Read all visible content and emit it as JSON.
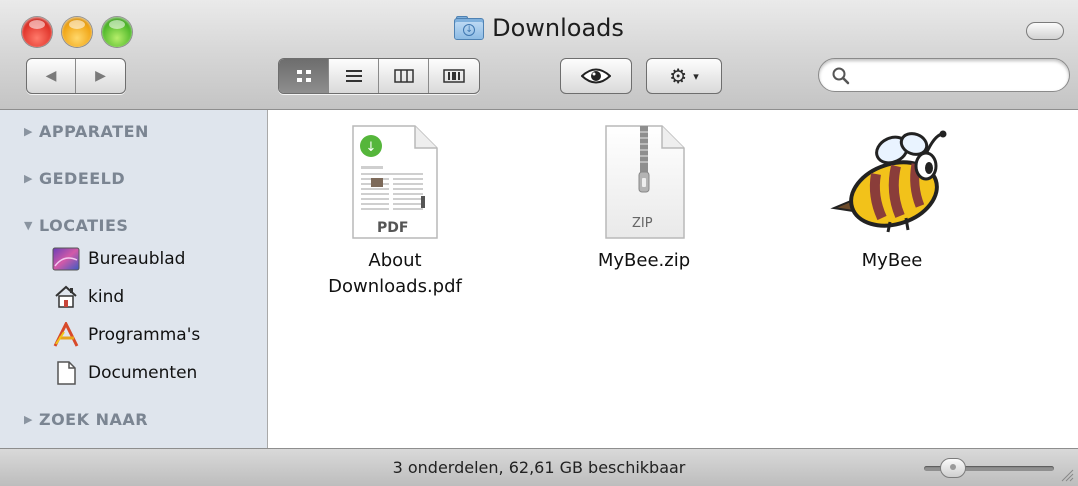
{
  "window": {
    "title": "Downloads",
    "folder_icon": "downloads-folder-icon"
  },
  "toolbar": {
    "back_icon": "◀",
    "forward_icon": "▶",
    "view_buttons": [
      {
        "name": "icon-view",
        "glyph": "▦",
        "active": true
      },
      {
        "name": "list-view",
        "glyph": "≡",
        "active": false
      },
      {
        "name": "column-view",
        "glyph": "◫",
        "active": false
      },
      {
        "name": "coverflow-view",
        "glyph": "▥",
        "active": false
      }
    ],
    "quicklook_icon": "eye-icon",
    "action_icon": "gear-icon",
    "action_caret": "▾",
    "search": {
      "value": "",
      "placeholder": ""
    }
  },
  "sidebar": {
    "sections": [
      {
        "label": "APPARATEN",
        "expanded": false
      },
      {
        "label": "GEDEELD",
        "expanded": false
      },
      {
        "label": "LOCATIES",
        "expanded": true
      },
      {
        "label": "ZOEK NAAR",
        "expanded": false
      }
    ],
    "items": [
      {
        "label": "Bureaublad",
        "icon": "desktop-icon"
      },
      {
        "label": "kind",
        "icon": "home-icon"
      },
      {
        "label": "Programma's",
        "icon": "applications-icon"
      },
      {
        "label": "Documenten",
        "icon": "documents-icon"
      }
    ]
  },
  "files": [
    {
      "label_line1": "About",
      "label_line2": "Downloads.pdf",
      "icon": "pdf-icon",
      "badge": "PDF"
    },
    {
      "label_line1": "MyBee.zip",
      "label_line2": "",
      "icon": "zip-icon",
      "badge": "ZIP"
    },
    {
      "label_line1": "MyBee",
      "label_line2": "",
      "icon": "bee-app-icon",
      "badge": ""
    }
  ],
  "status": {
    "text": "3 onderdelen, 62,61 GB beschikbaar",
    "zoom_level": 0.15
  }
}
